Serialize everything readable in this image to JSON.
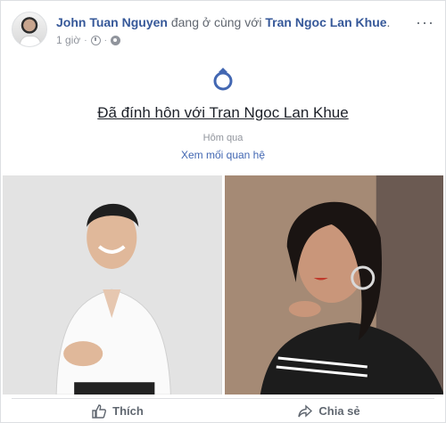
{
  "post": {
    "author_name": "John Tuan Nguyen",
    "with_text": "đang ở cùng với",
    "tagged_name": "Tran Ngoc Lan Khue",
    "period": ".",
    "time": "1 giờ",
    "separator": "·",
    "more_label": "···"
  },
  "life_event": {
    "icon": "ring-icon",
    "title": "Đã đính hôn với Tran Ngoc Lan Khue",
    "date": "Hôm qua",
    "see_relationship": "Xem mối quan hệ"
  },
  "photos": [
    {
      "name": "man-portrait-photo"
    },
    {
      "name": "woman-portrait-photo"
    }
  ],
  "actions": {
    "like_label": "Thích",
    "share_label": "Chia sẻ"
  },
  "colors": {
    "link": "#365899",
    "accent": "#4267b2",
    "muted": "#90949c"
  }
}
